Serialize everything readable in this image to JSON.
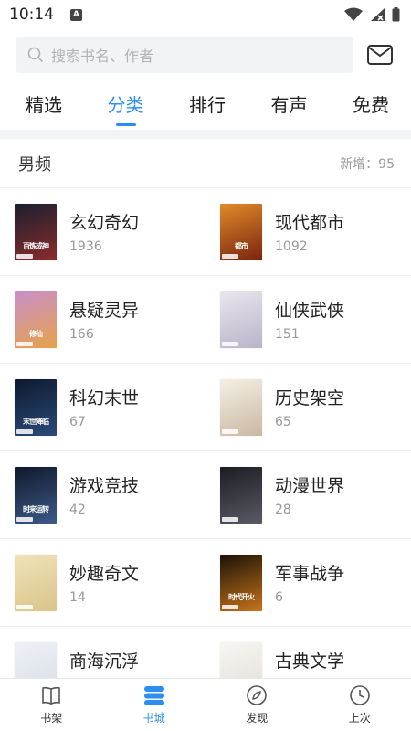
{
  "status_bar": {
    "time": "10:14",
    "app_icon_letter": "A"
  },
  "search": {
    "placeholder": "搜索书名、作者"
  },
  "tabs": [
    {
      "label": "精选",
      "active": false
    },
    {
      "label": "分类",
      "active": true
    },
    {
      "label": "排行",
      "active": false
    },
    {
      "label": "有声",
      "active": false
    },
    {
      "label": "免费",
      "active": false
    }
  ],
  "section": {
    "title": "男频",
    "new_count": "新增：95"
  },
  "categories": [
    {
      "name": "玄幻奇幻",
      "count": "1936",
      "cover_colors": [
        "#1a1f2e",
        "#8a2c2c"
      ],
      "cover_text": "百炼成神"
    },
    {
      "name": "现代都市",
      "count": "1092",
      "cover_colors": [
        "#e08a2a",
        "#7a2410"
      ],
      "cover_text": "都市"
    },
    {
      "name": "悬疑灵异",
      "count": "166",
      "cover_colors": [
        "#c98fc9",
        "#e6a24a"
      ],
      "cover_text": "修仙"
    },
    {
      "name": "仙侠武侠",
      "count": "151",
      "cover_colors": [
        "#e8e6ee",
        "#b9b4c8"
      ],
      "cover_text": ""
    },
    {
      "name": "科幻末世",
      "count": "67",
      "cover_colors": [
        "#0d1a2e",
        "#2b4a78"
      ],
      "cover_text": "末世降临"
    },
    {
      "name": "历史架空",
      "count": "65",
      "cover_colors": [
        "#f4efe6",
        "#c9b9a0"
      ],
      "cover_text": ""
    },
    {
      "name": "游戏竞技",
      "count": "42",
      "cover_colors": [
        "#10182a",
        "#3d5a8a"
      ],
      "cover_text": "时来运转"
    },
    {
      "name": "动漫世界",
      "count": "28",
      "cover_colors": [
        "#1c1c22",
        "#5a5a66"
      ],
      "cover_text": ""
    },
    {
      "name": "妙趣奇文",
      "count": "14",
      "cover_colors": [
        "#f1e3b8",
        "#d9c48a"
      ],
      "cover_text": ""
    },
    {
      "name": "军事战争",
      "count": "6",
      "cover_colors": [
        "#1a1208",
        "#c8741a"
      ],
      "cover_text": "时代开火"
    },
    {
      "name": "商海沉浮",
      "count": "5",
      "cover_colors": [
        "#eef1f5",
        "#d6dde8"
      ],
      "cover_text": ""
    },
    {
      "name": "古典文学",
      "count": "2",
      "cover_colors": [
        "#f7f6f3",
        "#e2ded6"
      ],
      "cover_text": ""
    }
  ],
  "bottom_nav": [
    {
      "label": "书架",
      "icon": "book-icon",
      "active": false
    },
    {
      "label": "书城",
      "icon": "store-icon",
      "active": true
    },
    {
      "label": "发现",
      "icon": "compass-icon",
      "active": false
    },
    {
      "label": "上次",
      "icon": "clock-icon",
      "active": false
    }
  ],
  "colors": {
    "accent": "#2a8ff0",
    "divider": "#eceef0"
  }
}
